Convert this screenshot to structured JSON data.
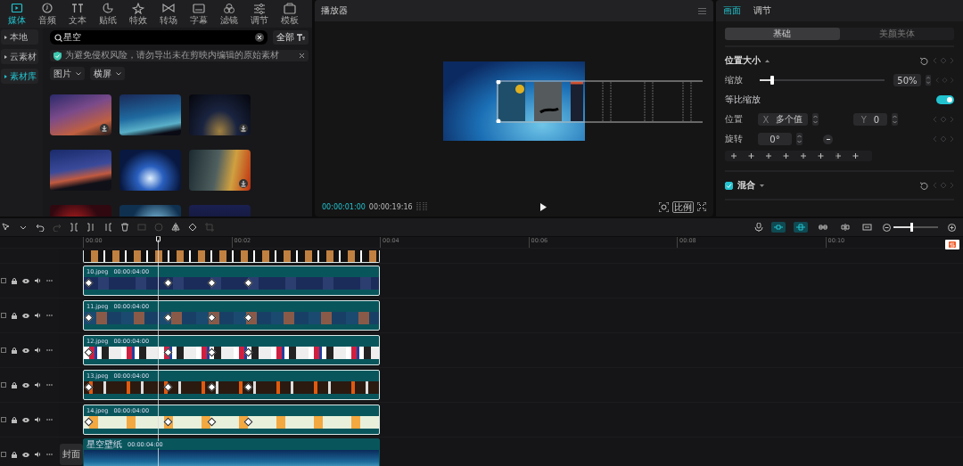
{
  "media_panel": {
    "tabs": [
      {
        "label": "媒体",
        "selected": true
      },
      {
        "label": "音频",
        "selected": false
      },
      {
        "label": "文本",
        "selected": false
      },
      {
        "label": "贴纸",
        "selected": false
      },
      {
        "label": "特效",
        "selected": false
      },
      {
        "label": "转场",
        "selected": false
      },
      {
        "label": "字幕",
        "selected": false
      },
      {
        "label": "滤镜",
        "selected": false
      },
      {
        "label": "调节",
        "selected": false
      },
      {
        "label": "模板",
        "selected": false
      }
    ],
    "sidebar": {
      "items": [
        {
          "label": "本地",
          "selected": false
        },
        {
          "label": "云素材",
          "selected": false
        },
        {
          "label": "素材库",
          "selected": true
        }
      ]
    },
    "search": {
      "value": "星空"
    },
    "filter_button": "全部",
    "notice": "为避免侵权风险，请勿导出未在剪映内编辑的原始素材",
    "dropdowns": [
      "图片",
      "横屏"
    ],
    "thumbnails": [
      {
        "downloadable": true
      },
      {
        "downloadable": false
      },
      {
        "downloadable": true
      },
      {
        "downloadable": false
      },
      {
        "downloadable": false
      },
      {
        "downloadable": true
      }
    ]
  },
  "player": {
    "title": "播放器",
    "current_time": "00:00:01:00",
    "total_time": "00:00:19:16",
    "ratio_button": "比例"
  },
  "inspector": {
    "tabs": [
      {
        "label": "画面",
        "selected": true
      },
      {
        "label": "调节",
        "selected": false
      }
    ],
    "segments": [
      {
        "label": "基础",
        "selected": true
      },
      {
        "label": "美颜美体",
        "selected": false
      }
    ],
    "section_title": "位置大小",
    "scale": {
      "label": "缩放",
      "level": 0.1,
      "value": "50%"
    },
    "uniform_scale": {
      "label": "等比缩放",
      "on": true
    },
    "position": {
      "label": "位置",
      "x_label": "X",
      "x_value": "多个值",
      "y_label": "Y",
      "y_value": "0"
    },
    "rotation": {
      "label": "旋转",
      "value": "0°"
    },
    "blend": {
      "label": "混合",
      "checked": true
    }
  },
  "timeline": {
    "toolbar_toggles": [
      {
        "on": true
      },
      {
        "on": true
      },
      {
        "on": false
      },
      {
        "on": false
      },
      {
        "on": false
      }
    ],
    "zoom": {
      "level": 0.4
    },
    "ruler": [
      "00:00",
      "00:02",
      "00:04",
      "00:06",
      "00:08",
      "00:10"
    ],
    "tracks": [
      {
        "kind": "partial"
      },
      {
        "kind": "overlay",
        "name": "10.jpeg",
        "duration": "00:00:04:00"
      },
      {
        "kind": "overlay",
        "name": "11.jpeg",
        "duration": "00:00:04:00"
      },
      {
        "kind": "overlay",
        "name": "12.jpeg",
        "duration": "00:00:04:00"
      },
      {
        "kind": "overlay",
        "name": "13.jpeg",
        "duration": "00:00:04:00"
      },
      {
        "kind": "overlay",
        "name": "14.jpeg",
        "duration": "00:00:04:00"
      },
      {
        "kind": "main",
        "name": "星空壁纸",
        "duration": "00:00:04:00",
        "cover_button": "封面"
      }
    ]
  }
}
